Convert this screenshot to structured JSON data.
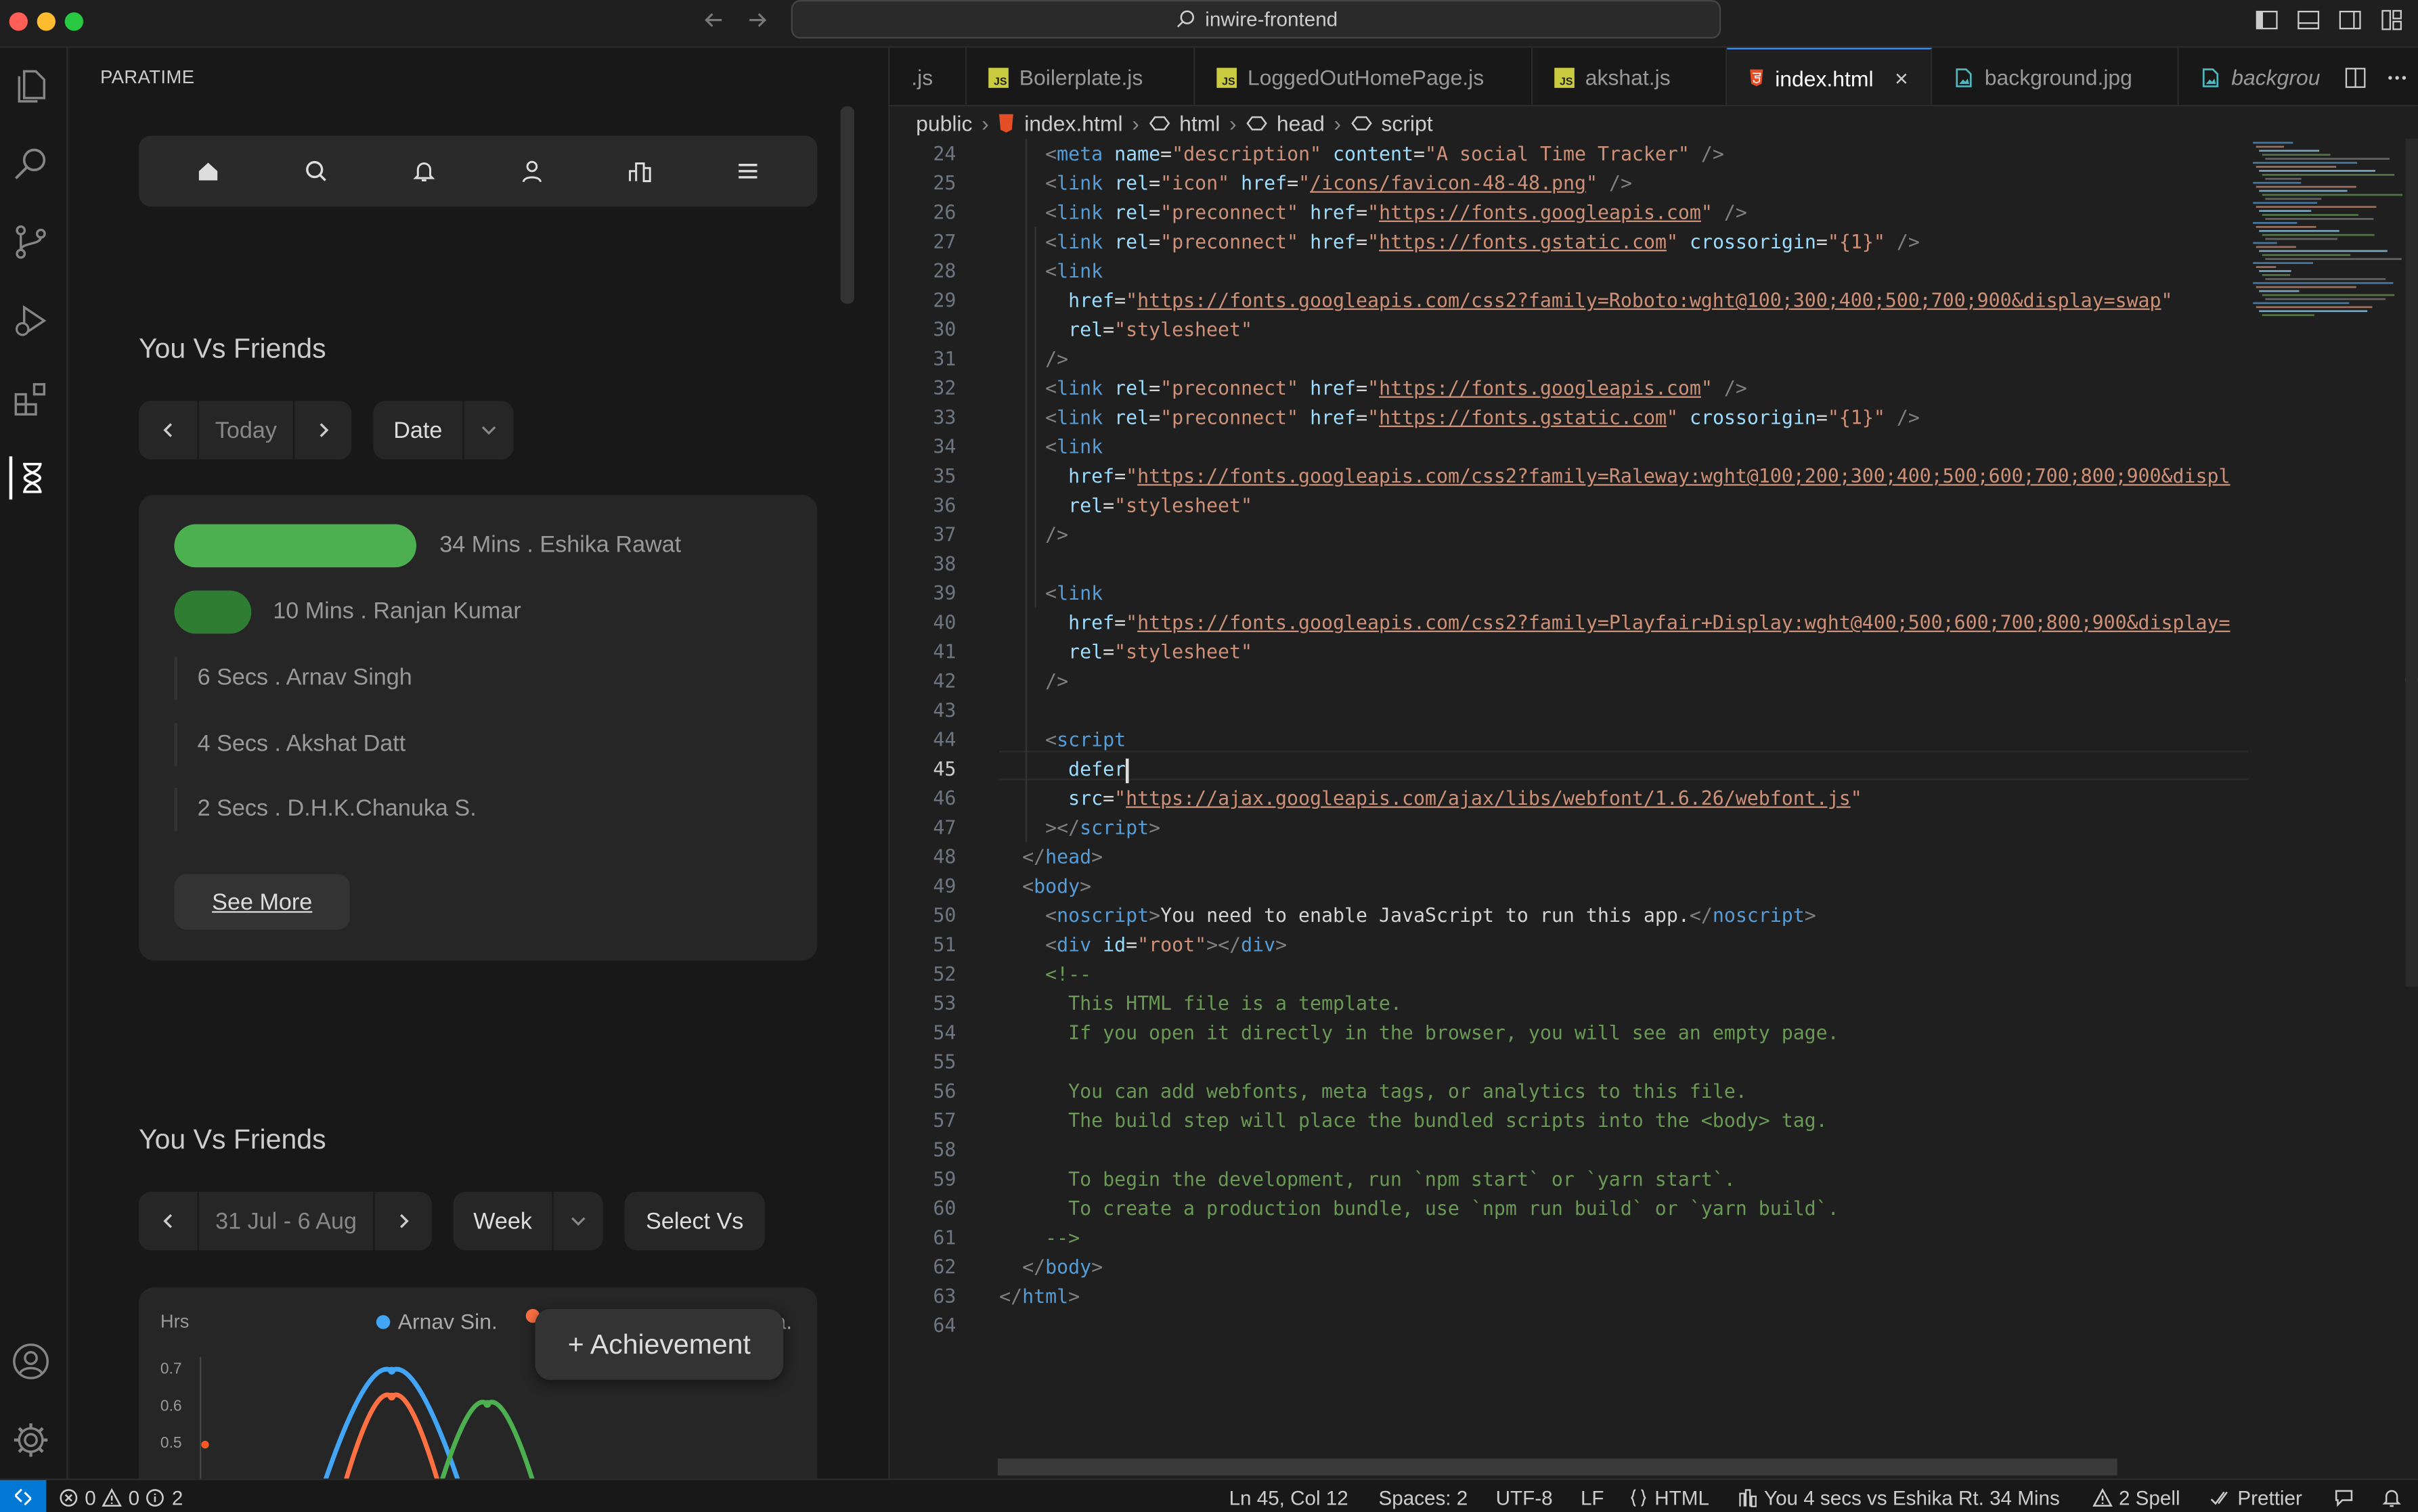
{
  "window": {
    "search_text": "inwire-frontend"
  },
  "sidebar": {
    "title": "PARATIME",
    "nav_icons": [
      "home-icon",
      "search-icon",
      "bell-icon",
      "user-icon",
      "leaderboard-icon",
      "menu-icon"
    ],
    "section1": {
      "title": "You Vs Friends",
      "prev": "<",
      "period": "Today",
      "next": ">",
      "dropdown": "Date",
      "rows": [
        {
          "text": "34 Mins . Eshika Rawat",
          "bar_fraction": 1.0
        },
        {
          "text": "10 Mins . Ranjan Kumar",
          "bar_fraction": 0.31
        },
        {
          "text": "6 Secs . Arnav Singh"
        },
        {
          "text": "4 Secs . Akshat Datt"
        },
        {
          "text": "2 Secs . D.H.K.Chanuka S."
        }
      ],
      "see_more": "See More"
    },
    "section2": {
      "title": "You Vs Friends",
      "prev": "<",
      "period": "31 Jul - 6 Aug",
      "next": ">",
      "dropdown": "Week",
      "select_vs": "Select Vs"
    },
    "achievement_button": "+ Achievement",
    "chart_data": {
      "type": "line",
      "ylabel": "Hrs",
      "yticks": [
        "0.7",
        "0.6",
        "0.5"
      ],
      "legend": [
        "Arnav Sin.",
        "a."
      ],
      "series": [
        {
          "name": "Arnav Sin.",
          "color": "#42a5f5",
          "peak": 0.7
        },
        {
          "color": "#ff7043",
          "peak": 0.63
        },
        {
          "color": "#4caf50",
          "peak": 0.61
        }
      ]
    }
  },
  "tabs": [
    {
      "label": ".js",
      "icon": "none"
    },
    {
      "label": "Boilerplate.js",
      "icon": "js"
    },
    {
      "label": "LoggedOutHomePage.js",
      "icon": "js"
    },
    {
      "label": "akshat.js",
      "icon": "js"
    },
    {
      "label": "index.html",
      "icon": "html",
      "active": true
    },
    {
      "label": "background.jpg",
      "icon": "image"
    },
    {
      "label": "backgrou",
      "icon": "image"
    }
  ],
  "breadcrumb": [
    "public",
    "index.html",
    "html",
    "head",
    "script"
  ],
  "code": {
    "current_line": "45",
    "lines": [
      {
        "n": "24",
        "p": [
          [
            "    ",
            "tx"
          ],
          [
            "<",
            "tg"
          ],
          [
            "meta",
            "tn"
          ],
          [
            " name",
            "at"
          ],
          [
            "=",
            "tx"
          ],
          [
            "\"description\"",
            "st"
          ],
          [
            " content",
            "at"
          ],
          [
            "=",
            "tx"
          ],
          [
            "\"A social Time Tracker\"",
            "st"
          ],
          [
            " />",
            "tg"
          ]
        ]
      },
      {
        "n": "25",
        "p": [
          [
            "    ",
            "tx"
          ],
          [
            "<",
            "tg"
          ],
          [
            "link",
            "tn"
          ],
          [
            " rel",
            "at"
          ],
          [
            "=",
            "tx"
          ],
          [
            "\"icon\"",
            "st"
          ],
          [
            " href",
            "at"
          ],
          [
            "=",
            "tx"
          ],
          [
            "\"",
            "st"
          ],
          [
            "/icons/favicon-48-48.png",
            "url"
          ],
          [
            "\"",
            "st"
          ],
          [
            " />",
            "tg"
          ]
        ]
      },
      {
        "n": "26",
        "p": [
          [
            "    ",
            "tx"
          ],
          [
            "<",
            "tg"
          ],
          [
            "link",
            "tn"
          ],
          [
            " rel",
            "at"
          ],
          [
            "=",
            "tx"
          ],
          [
            "\"preconnect\"",
            "st"
          ],
          [
            " href",
            "at"
          ],
          [
            "=",
            "tx"
          ],
          [
            "\"",
            "st"
          ],
          [
            "https://fonts.googleapis.com",
            "url"
          ],
          [
            "\"",
            "st"
          ],
          [
            " />",
            "tg"
          ]
        ]
      },
      {
        "n": "27",
        "p": [
          [
            "    ",
            "tx"
          ],
          [
            "<",
            "tg"
          ],
          [
            "link",
            "tn"
          ],
          [
            " rel",
            "at"
          ],
          [
            "=",
            "tx"
          ],
          [
            "\"preconnect\"",
            "st"
          ],
          [
            " href",
            "at"
          ],
          [
            "=",
            "tx"
          ],
          [
            "\"",
            "st"
          ],
          [
            "https://fonts.gstatic.com",
            "url"
          ],
          [
            "\"",
            "st"
          ],
          [
            " crossorigin",
            "at"
          ],
          [
            "=",
            "tx"
          ],
          [
            "\"{1}\"",
            "st"
          ],
          [
            " />",
            "tg"
          ]
        ]
      },
      {
        "n": "28",
        "p": [
          [
            "    ",
            "tx"
          ],
          [
            "<",
            "tg"
          ],
          [
            "link",
            "tn"
          ]
        ]
      },
      {
        "n": "29",
        "p": [
          [
            "      href",
            "at"
          ],
          [
            "=",
            "tx"
          ],
          [
            "\"",
            "st"
          ],
          [
            "https://fonts.googleapis.com/css2?family=Roboto:wght@100;300;400;500;700;900&display=swap",
            "url"
          ],
          [
            "\"",
            "st"
          ]
        ]
      },
      {
        "n": "30",
        "p": [
          [
            "      rel",
            "at"
          ],
          [
            "=",
            "tx"
          ],
          [
            "\"stylesheet\"",
            "st"
          ]
        ]
      },
      {
        "n": "31",
        "p": [
          [
            "    />",
            "tg"
          ]
        ]
      },
      {
        "n": "32",
        "p": [
          [
            "    ",
            "tx"
          ],
          [
            "<",
            "tg"
          ],
          [
            "link",
            "tn"
          ],
          [
            " rel",
            "at"
          ],
          [
            "=",
            "tx"
          ],
          [
            "\"preconnect\"",
            "st"
          ],
          [
            " href",
            "at"
          ],
          [
            "=",
            "tx"
          ],
          [
            "\"",
            "st"
          ],
          [
            "https://fonts.googleapis.com",
            "url"
          ],
          [
            "\"",
            "st"
          ],
          [
            " />",
            "tg"
          ]
        ]
      },
      {
        "n": "33",
        "p": [
          [
            "    ",
            "tx"
          ],
          [
            "<",
            "tg"
          ],
          [
            "link",
            "tn"
          ],
          [
            " rel",
            "at"
          ],
          [
            "=",
            "tx"
          ],
          [
            "\"preconnect\"",
            "st"
          ],
          [
            " href",
            "at"
          ],
          [
            "=",
            "tx"
          ],
          [
            "\"",
            "st"
          ],
          [
            "https://fonts.gstatic.com",
            "url"
          ],
          [
            "\"",
            "st"
          ],
          [
            " crossorigin",
            "at"
          ],
          [
            "=",
            "tx"
          ],
          [
            "\"{1}\"",
            "st"
          ],
          [
            " />",
            "tg"
          ]
        ]
      },
      {
        "n": "34",
        "p": [
          [
            "    ",
            "tx"
          ],
          [
            "<",
            "tg"
          ],
          [
            "link",
            "tn"
          ]
        ]
      },
      {
        "n": "35",
        "p": [
          [
            "      href",
            "at"
          ],
          [
            "=",
            "tx"
          ],
          [
            "\"",
            "st"
          ],
          [
            "https://fonts.googleapis.com/css2?family=Raleway:wght@100;200;300;400;500;600;700;800;900&displ",
            "url"
          ]
        ]
      },
      {
        "n": "36",
        "p": [
          [
            "      rel",
            "at"
          ],
          [
            "=",
            "tx"
          ],
          [
            "\"stylesheet\"",
            "st"
          ]
        ]
      },
      {
        "n": "37",
        "p": [
          [
            "    />",
            "tg"
          ]
        ]
      },
      {
        "n": "38",
        "p": []
      },
      {
        "n": "39",
        "p": [
          [
            "    ",
            "tx"
          ],
          [
            "<",
            "tg"
          ],
          [
            "link",
            "tn"
          ]
        ]
      },
      {
        "n": "40",
        "p": [
          [
            "      href",
            "at"
          ],
          [
            "=",
            "tx"
          ],
          [
            "\"",
            "st"
          ],
          [
            "https://fonts.googleapis.com/css2?family=Playfair+Display:wght@400;500;600;700;800;900&display=",
            "url"
          ]
        ]
      },
      {
        "n": "41",
        "p": [
          [
            "      rel",
            "at"
          ],
          [
            "=",
            "tx"
          ],
          [
            "\"stylesheet\"",
            "st"
          ]
        ]
      },
      {
        "n": "42",
        "p": [
          [
            "    />",
            "tg"
          ]
        ]
      },
      {
        "n": "43",
        "p": []
      },
      {
        "n": "44",
        "p": [
          [
            "    ",
            "tx"
          ],
          [
            "<",
            "tg"
          ],
          [
            "script",
            "tn"
          ]
        ]
      },
      {
        "n": "45",
        "p": [
          [
            "      defer",
            "at"
          ]
        ]
      },
      {
        "n": "46",
        "p": [
          [
            "      src",
            "at"
          ],
          [
            "=",
            "tx"
          ],
          [
            "\"",
            "st"
          ],
          [
            "https://ajax.googleapis.com/ajax/libs/webfont/1.6.26/webfont.js",
            "url"
          ],
          [
            "\"",
            "st"
          ]
        ]
      },
      {
        "n": "47",
        "p": [
          [
            "    ></",
            "tg"
          ],
          [
            "script",
            "tn"
          ],
          [
            ">",
            "tg"
          ]
        ]
      },
      {
        "n": "48",
        "p": [
          [
            "  </",
            "tg"
          ],
          [
            "head",
            "tn"
          ],
          [
            ">",
            "tg"
          ]
        ]
      },
      {
        "n": "49",
        "p": [
          [
            "  <",
            "tg"
          ],
          [
            "body",
            "tn"
          ],
          [
            ">",
            "tg"
          ]
        ]
      },
      {
        "n": "50",
        "p": [
          [
            "    <",
            "tg"
          ],
          [
            "noscript",
            "tn"
          ],
          [
            ">",
            "tg"
          ],
          [
            "You need to enable JavaScript to run this app.",
            "tx"
          ],
          [
            "</",
            "tg"
          ],
          [
            "noscript",
            "tn"
          ],
          [
            ">",
            "tg"
          ]
        ]
      },
      {
        "n": "51",
        "p": [
          [
            "    <",
            "tg"
          ],
          [
            "div",
            "tn"
          ],
          [
            " id",
            "at"
          ],
          [
            "=",
            "tx"
          ],
          [
            "\"root\"",
            "st"
          ],
          [
            "></",
            "tg"
          ],
          [
            "div",
            "tn"
          ],
          [
            ">",
            "tg"
          ]
        ]
      },
      {
        "n": "52",
        "p": [
          [
            "    <!--",
            "cm"
          ]
        ]
      },
      {
        "n": "53",
        "p": [
          [
            "      This HTML file is a template.",
            "cm"
          ]
        ]
      },
      {
        "n": "54",
        "p": [
          [
            "      If you open it directly in the browser, you will see an empty page.",
            "cm"
          ]
        ]
      },
      {
        "n": "55",
        "p": []
      },
      {
        "n": "56",
        "p": [
          [
            "      You can add webfonts, meta tags, or analytics to this file.",
            "cm"
          ]
        ]
      },
      {
        "n": "57",
        "p": [
          [
            "      The build step will place the bundled scripts into the <body> tag.",
            "cm"
          ]
        ]
      },
      {
        "n": "58",
        "p": []
      },
      {
        "n": "59",
        "p": [
          [
            "      To begin the development, run `npm start` or `yarn start`.",
            "cm"
          ]
        ]
      },
      {
        "n": "60",
        "p": [
          [
            "      To create a production bundle, use `npm run build` or `yarn build`.",
            "cm"
          ]
        ]
      },
      {
        "n": "61",
        "p": [
          [
            "    -->",
            "cm"
          ]
        ]
      },
      {
        "n": "62",
        "p": [
          [
            "  </",
            "tg"
          ],
          [
            "body",
            "tn"
          ],
          [
            ">",
            "tg"
          ]
        ]
      },
      {
        "n": "63",
        "p": [
          [
            "</",
            "tg"
          ],
          [
            "html",
            "tn"
          ],
          [
            ">",
            "tg"
          ]
        ]
      },
      {
        "n": "64",
        "p": []
      }
    ]
  },
  "status": {
    "errors": "0",
    "warnings": "0",
    "infos": "2",
    "position": "Ln 45, Col 12",
    "spaces": "Spaces: 2",
    "encoding": "UTF-8",
    "eol": "LF",
    "language": "HTML",
    "paratime": "You 4 secs vs Eshika Rt. 34 Mins",
    "spell": "2 Spell",
    "prettier": "Prettier"
  },
  "colors": {
    "accent": "#0078d4",
    "green": "#4caf50",
    "dark_green": "#2e7d32"
  }
}
